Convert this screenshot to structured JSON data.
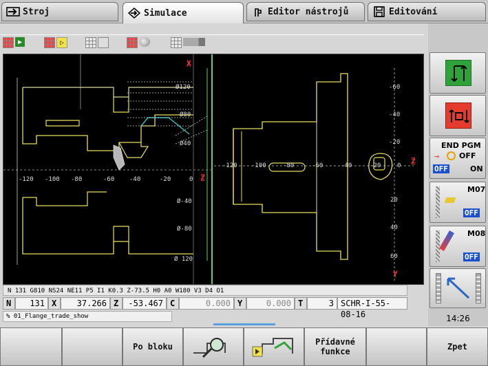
{
  "tabs": [
    {
      "label": "Stroj",
      "icon": "arrow-right-box-icon"
    },
    {
      "label": "Simulace",
      "icon": "diamond-arrow-icon"
    },
    {
      "label": "Editor nástrojů",
      "icon": "tool-holder-icon"
    },
    {
      "label": "Editování",
      "icon": "document-icon"
    }
  ],
  "view": {
    "axis_x_left": "X",
    "axis_z_left": "Z",
    "axis_y_right": "Y",
    "axis_z_right": "Z",
    "left_ticks_h": [
      "-120",
      "-100",
      "-80",
      "-60",
      "-40",
      "-20",
      "0"
    ],
    "left_ticks_v": [
      "Ø120",
      "Ø80",
      "Ø40",
      "Ø-40",
      "Ø-80",
      "Ø 120"
    ],
    "right_ticks_h": [
      "-120",
      "-100",
      "-80",
      "-60",
      "-40",
      "-20",
      "0"
    ],
    "right_ticks_v": [
      "-60",
      "-40",
      "-20",
      "20",
      "40",
      "60"
    ]
  },
  "nc_line": "N 131   G810 NS24 NE11 P5 I1 K0.3 Z-73.5 H0 A0 W180 V3 D4 O1",
  "position": {
    "n_label": "N",
    "n_val": "131",
    "x_label": "X",
    "x_val": "37.266",
    "z_label": "Z",
    "z_val": "-53.467",
    "c_label": "C",
    "c_val": "0.000",
    "y_label": "Y",
    "y_val": "0.000",
    "t_label": "T",
    "t_val": "3",
    "tool_id": "SCHR-I-55-08-16"
  },
  "program": "% 01_Flange_trade_show",
  "right_keys": {
    "end_pgm": "END PGM",
    "off": "OFF",
    "on": "ON",
    "off_tag": "OFF",
    "m07": "M07",
    "m07_state": "OFF",
    "m08": "M08",
    "m08_state": "OFF"
  },
  "time": "14:26",
  "bottom_keys": {
    "po_bloku": "Po bloku",
    "pridavne_1": "Přídavné",
    "pridavne_2": "funkce",
    "zpet": "Zpet"
  },
  "colors": {
    "green_key": "#2fa33a",
    "red_key": "#e53b2f",
    "off_blue": "#1b4fd1",
    "contour": "#e8e060"
  }
}
